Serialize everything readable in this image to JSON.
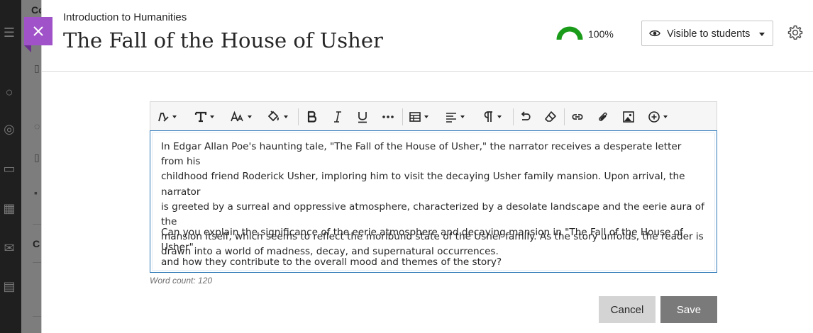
{
  "background": {
    "partial_heading": "Co",
    "partial_section": "C"
  },
  "header": {
    "course_name": "Introduction to Humanities",
    "title": "The Fall of the House of Usher",
    "progress": {
      "value_percent": 100,
      "label": "100%",
      "color": "#1a9b1a"
    },
    "visibility": {
      "label": "Visible to students",
      "icon": "eye-icon"
    },
    "settings_icon": "gear-icon",
    "close_icon": "close-icon",
    "accent_color": "#a052c8"
  },
  "toolbar": {
    "buttons": [
      {
        "name": "paragraph-style",
        "icon": "pen-icon",
        "has_dropdown": true
      },
      {
        "name": "text-format",
        "icon": "text-format-icon",
        "has_dropdown": true
      },
      {
        "name": "font-size",
        "icon": "font-size-icon",
        "has_dropdown": true
      },
      {
        "name": "text-color",
        "icon": "paint-bucket-icon",
        "has_dropdown": true
      },
      {
        "name": "bold",
        "icon": "bold-icon",
        "has_dropdown": false
      },
      {
        "name": "italic",
        "icon": "italic-icon",
        "has_dropdown": false
      },
      {
        "name": "underline",
        "icon": "underline-icon",
        "has_dropdown": false
      },
      {
        "name": "more",
        "icon": "more-icon",
        "has_dropdown": false
      },
      {
        "name": "table",
        "icon": "table-icon",
        "has_dropdown": true
      },
      {
        "name": "align",
        "icon": "align-icon",
        "has_dropdown": true
      },
      {
        "name": "paragraph",
        "icon": "pilcrow-icon",
        "has_dropdown": true
      },
      {
        "name": "undo",
        "icon": "undo-icon",
        "has_dropdown": false
      },
      {
        "name": "clear-format",
        "icon": "eraser-icon",
        "has_dropdown": false
      },
      {
        "name": "link",
        "icon": "link-icon",
        "has_dropdown": false
      },
      {
        "name": "attach",
        "icon": "paperclip-icon",
        "has_dropdown": false
      },
      {
        "name": "image",
        "icon": "image-icon",
        "has_dropdown": false
      },
      {
        "name": "insert",
        "icon": "plus-circle-icon",
        "has_dropdown": true
      }
    ]
  },
  "editor": {
    "paragraphs": [
      "In Edgar Allan Poe's haunting tale, \"The Fall of the House of Usher,\" the narrator receives a desperate letter from his childhood friend Roderick Usher, imploring him to visit the decaying Usher family mansion. Upon arrival, the narrator is greeted by a surreal and oppressive atmosphere, characterized by a desolate landscape and the eerie aura of the mansion itself, which seems to reflect the moribund state of the Usher family. As the story unfolds, the reader is drawn into a world of madness, decay, and supernatural occurrences.",
      "Can you explain the significance of the eerie atmosphere and decaying mansion in \"The Fall of the House of Usher\" and how they contribute to the overall mood and themes of the story?"
    ],
    "lines": [
      "In Edgar Allan Poe's haunting tale, \"The Fall of the House of Usher,\" the narrator receives a desperate letter from his",
      "childhood friend Roderick Usher, imploring him to visit the decaying Usher family mansion. Upon arrival, the narrator",
      "is greeted by a surreal and oppressive atmosphere, characterized by a desolate landscape and the eerie aura of the",
      "mansion itself, which seems to reflect the moribund state of the Usher family. As the story unfolds, the reader is",
      "drawn into a world of madness, decay, and supernatural occurrences.",
      "Can you explain the significance of the eerie atmosphere and decaying mansion in \"The Fall of the House of Usher\"",
      "and how they contribute to the overall mood and themes of the story?"
    ],
    "word_count": "Word count: 120"
  },
  "actions": {
    "cancel_label": "Cancel",
    "save_label": "Save"
  }
}
